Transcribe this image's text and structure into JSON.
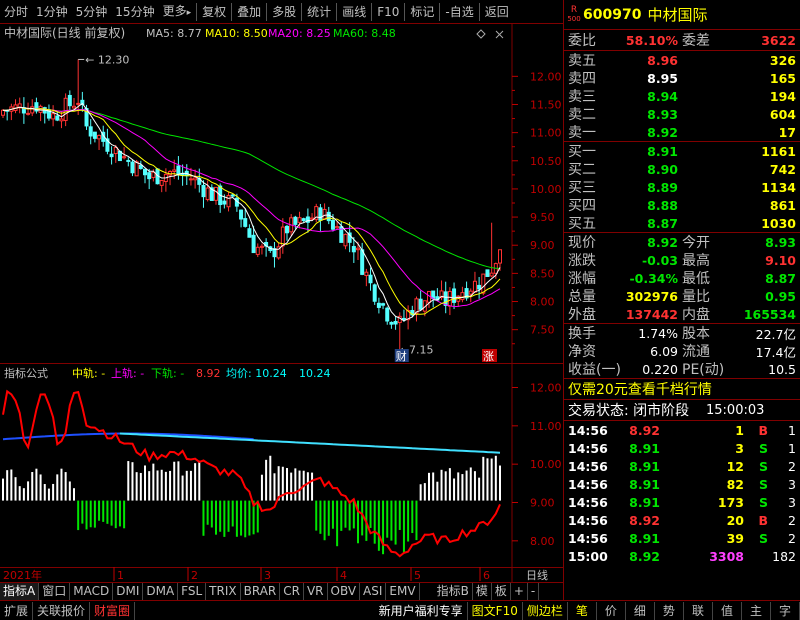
{
  "toolbar": {
    "items": [
      "分时",
      "1分钟",
      "5分钟",
      "15分钟",
      "更多",
      "复权",
      "叠加",
      "多股",
      "统计",
      "画线",
      "F10",
      "标记",
      "-自选",
      "返回"
    ],
    "more_arrow": "▸"
  },
  "main_chart": {
    "title": "中材国际(日线 前复权)",
    "ma5_label": "MA5: 8.77",
    "ma10_label": "MA10: 8.50",
    "ma20_label": "MA20: 8.25",
    "ma60_label": "MA60: 8.48",
    "high_marker": "12.30",
    "low_marker": "7.15",
    "cai_badge": "财",
    "zhang_badge": "涨",
    "y_ticks": [
      "12.00",
      "11.50",
      "11.00",
      "10.50",
      "10.00",
      "9.50",
      "9.00",
      "8.50",
      "8.00",
      "7.50"
    ],
    "colors": {
      "up": "#ff3232",
      "down": "#54ffff",
      "ma5": "#ffffff",
      "ma10": "#ffff00",
      "ma20": "#ff00ff",
      "ma60": "#00e600"
    }
  },
  "sub_chart": {
    "title": "指标公式",
    "mid_label": "中轨: -",
    "upper_label": "上轨: -",
    "lower_label": "下轨: -",
    "val_label": "8.92",
    "avg_label": "均价: 10.24",
    "avg_value": "10.24",
    "y_ticks": [
      "12.00",
      "11.00",
      "10.00",
      "9.00",
      "8.00"
    ]
  },
  "date_axis": {
    "year": "2021年",
    "months": [
      "1",
      "2",
      "3",
      "4",
      "5",
      "6"
    ],
    "right_label": "日线"
  },
  "tabs": [
    "指标A",
    "窗口",
    "MACD",
    "DMI",
    "DMA",
    "FSL",
    "TRIX",
    "BRAR",
    "CR",
    "VR",
    "OBV",
    "ASI",
    "EMV",
    "指标B",
    "模",
    "板",
    "+",
    "-"
  ],
  "bottom_tabs": {
    "left": [
      "扩展",
      "关联报价",
      "财富圈"
    ],
    "promo": "新用户福利专享",
    "right": [
      "图文F10",
      "侧边栏",
      "笔",
      "价",
      "细",
      "势",
      "联",
      "值",
      "主",
      "字"
    ]
  },
  "quote": {
    "badge_r": "R",
    "badge_num": "500",
    "code": "600970",
    "name": "中材国际",
    "weibi_label": "委比",
    "weibi": "58.10%",
    "weicha_label": "委差",
    "weicha": "3622",
    "asks": [
      {
        "label": "卖五",
        "price": "8.96",
        "vol": "326",
        "pc": "red"
      },
      {
        "label": "卖四",
        "price": "8.95",
        "vol": "165",
        "pc": "white"
      },
      {
        "label": "卖三",
        "price": "8.94",
        "vol": "194",
        "pc": "green"
      },
      {
        "label": "卖二",
        "price": "8.93",
        "vol": "604",
        "pc": "green"
      },
      {
        "label": "卖一",
        "price": "8.92",
        "vol": "17",
        "pc": "green"
      }
    ],
    "bids": [
      {
        "label": "买一",
        "price": "8.91",
        "vol": "1161",
        "pc": "green"
      },
      {
        "label": "买二",
        "price": "8.90",
        "vol": "742",
        "pc": "green"
      },
      {
        "label": "买三",
        "price": "8.89",
        "vol": "1134",
        "pc": "green"
      },
      {
        "label": "买四",
        "price": "8.88",
        "vol": "861",
        "pc": "green"
      },
      {
        "label": "买五",
        "price": "8.87",
        "vol": "1030",
        "pc": "green"
      }
    ],
    "stats": [
      {
        "l1": "现价",
        "v1": "8.92",
        "c1": "green",
        "l2": "今开",
        "v2": "8.93",
        "c2": "green"
      },
      {
        "l1": "涨跌",
        "v1": "-0.03",
        "c1": "green",
        "l2": "最高",
        "v2": "9.10",
        "c2": "red"
      },
      {
        "l1": "涨幅",
        "v1": "-0.34%",
        "c1": "green",
        "l2": "最低",
        "v2": "8.87",
        "c2": "green"
      },
      {
        "l1": "总量",
        "v1": "302976",
        "c1": "yellow",
        "l2": "量比",
        "v2": "0.95",
        "c2": "green"
      },
      {
        "l1": "外盘",
        "v1": "137442",
        "c1": "red",
        "l2": "内盘",
        "v2": "165534",
        "c2": "green"
      }
    ],
    "stats2": [
      {
        "l1": "换手",
        "v1": "1.74%",
        "c1": "white",
        "l2": "股本",
        "v2": "22.7亿",
        "c2": "white"
      },
      {
        "l1": "净资",
        "v1": "6.09",
        "c1": "white",
        "l2": "流通",
        "v2": "17.4亿",
        "c2": "white"
      },
      {
        "l1": "收益(一)",
        "v1": "0.220",
        "c1": "white",
        "l2": "PE(动)",
        "v2": "10.5",
        "c2": "white"
      }
    ],
    "promo": "仅需20元查看千档行情",
    "status_label": "交易状态: 闭市阶段",
    "status_time": "15:00:03",
    "ticks": [
      {
        "t": "14:56",
        "p": "8.92",
        "pc": "red",
        "v": "1",
        "vc": "yellow",
        "s": "B",
        "sc": "red",
        "n": "1"
      },
      {
        "t": "14:56",
        "p": "8.91",
        "pc": "green",
        "v": "3",
        "vc": "yellow",
        "s": "S",
        "sc": "green",
        "n": "1"
      },
      {
        "t": "14:56",
        "p": "8.91",
        "pc": "green",
        "v": "12",
        "vc": "yellow",
        "s": "S",
        "sc": "green",
        "n": "2"
      },
      {
        "t": "14:56",
        "p": "8.91",
        "pc": "green",
        "v": "82",
        "vc": "yellow",
        "s": "S",
        "sc": "green",
        "n": "3"
      },
      {
        "t": "14:56",
        "p": "8.91",
        "pc": "green",
        "v": "173",
        "vc": "yellow",
        "s": "S",
        "sc": "green",
        "n": "3"
      },
      {
        "t": "14:56",
        "p": "8.92",
        "pc": "red",
        "v": "20",
        "vc": "yellow",
        "s": "B",
        "sc": "red",
        "n": "2"
      },
      {
        "t": "14:56",
        "p": "8.91",
        "pc": "green",
        "v": "39",
        "vc": "yellow",
        "s": "S",
        "sc": "green",
        "n": "2"
      },
      {
        "t": "15:00",
        "p": "8.92",
        "pc": "green",
        "v": "3308",
        "vc": "magenta",
        "s": "",
        "sc": "white",
        "n": "182"
      }
    ]
  }
}
